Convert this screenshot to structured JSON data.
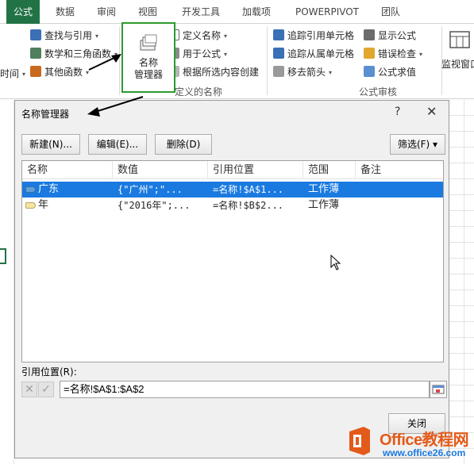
{
  "ribbon": {
    "tabs": [
      "公式",
      "数据",
      "审阅",
      "视图",
      "开发工具",
      "加载项",
      "POWERPIVOT",
      "团队"
    ],
    "active_tab": "公式",
    "library": {
      "lookup": "查找与引用",
      "math": "数学和三角函数",
      "other": "其他函数",
      "partial_left": "时间"
    },
    "name_manager": {
      "line1": "名称",
      "line2": "管理器"
    },
    "defined_names": {
      "define": "定义名称",
      "use_in_formula": "用于公式",
      "create_from_selection": "根据所选内容创建",
      "group_label": "定义的名称"
    },
    "auditing": {
      "trace_precedents": "追踪引用单元格",
      "trace_dependents": "追踪从属单元格",
      "remove_arrows": "移去箭头",
      "show_formulas": "显示公式",
      "error_check": "错误检查",
      "evaluate": "公式求值",
      "group_label": "公式审核"
    },
    "watch_window": "监视窗口"
  },
  "dialog": {
    "title": "名称管理器",
    "help": "?",
    "close": "✕",
    "buttons": {
      "new": "新建(N)...",
      "edit": "编辑(E)...",
      "delete": "删除(D)",
      "filter": "筛选(F) ▾"
    },
    "columns": [
      "名称",
      "数值",
      "引用位置",
      "范围",
      "备注"
    ],
    "rows": [
      {
        "name": "广东",
        "value": "{\"广州\";\"...",
        "refers_to": "=名称!$A$1...",
        "scope": "工作薄",
        "comment": "",
        "selected": true
      },
      {
        "name": "年",
        "value": "{\"2016年\";...",
        "refers_to": "=名称!$B$2...",
        "scope": "工作薄",
        "comment": "",
        "selected": false
      }
    ],
    "refers_to_label": "引用位置(R):",
    "refers_to_value": "=名称!$A$1:$A$2",
    "close_button": "关闭"
  },
  "watermark": {
    "main": "Office教程网",
    "sub": "www.office26.com"
  },
  "colors": {
    "accent": "#217346",
    "selection": "#1a7ae0",
    "highlight_box": "#2e9a2e",
    "watermark_orange": "#e35a1a"
  }
}
